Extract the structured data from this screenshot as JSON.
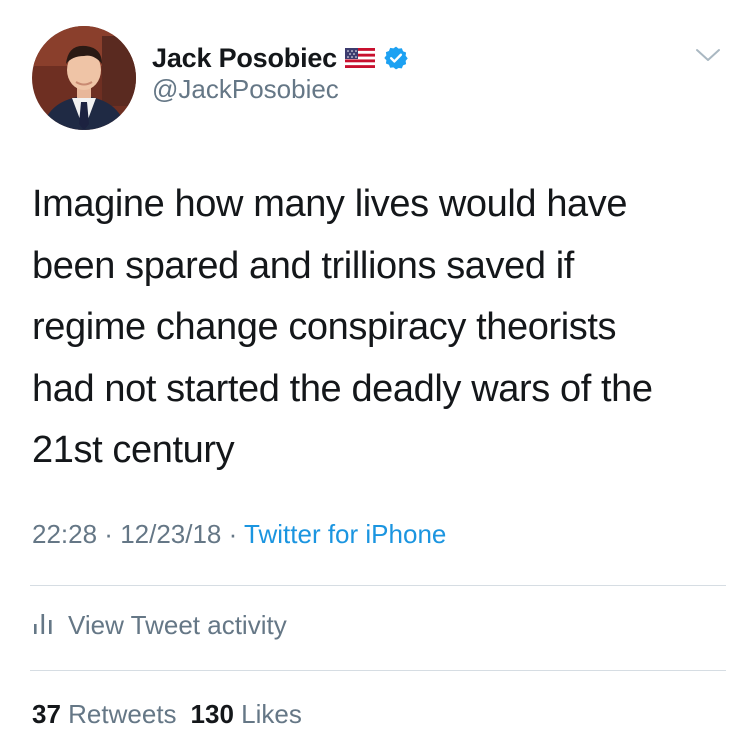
{
  "tweet": {
    "author": {
      "name": "Jack Posobiec",
      "handle": "@JackPosobiec",
      "badges": [
        "us-flag-icon",
        "verified-icon"
      ],
      "avatar": "profile-photo"
    },
    "text_lines": [
      "Imagine how many lives would have",
      "been spared and trillions saved if",
      "regime change conspiracy theorists",
      "had not started the deadly wars of the",
      "21st century"
    ],
    "meta": {
      "time": "22:28",
      "date": "12/23/18",
      "separator": " · ",
      "source": "Twitter for iPhone"
    },
    "activity": {
      "icon": "bar-chart-icon",
      "label": "View Tweet activity"
    },
    "stats": {
      "retweets_count": "37",
      "retweets_label": "Retweets",
      "likes_count": "130",
      "likes_label": "Likes"
    }
  },
  "colors": {
    "text": "#14171a",
    "secondary": "#657786",
    "link": "#1b95e0",
    "divider": "#d6dde3",
    "verified": "#1da1f2"
  }
}
